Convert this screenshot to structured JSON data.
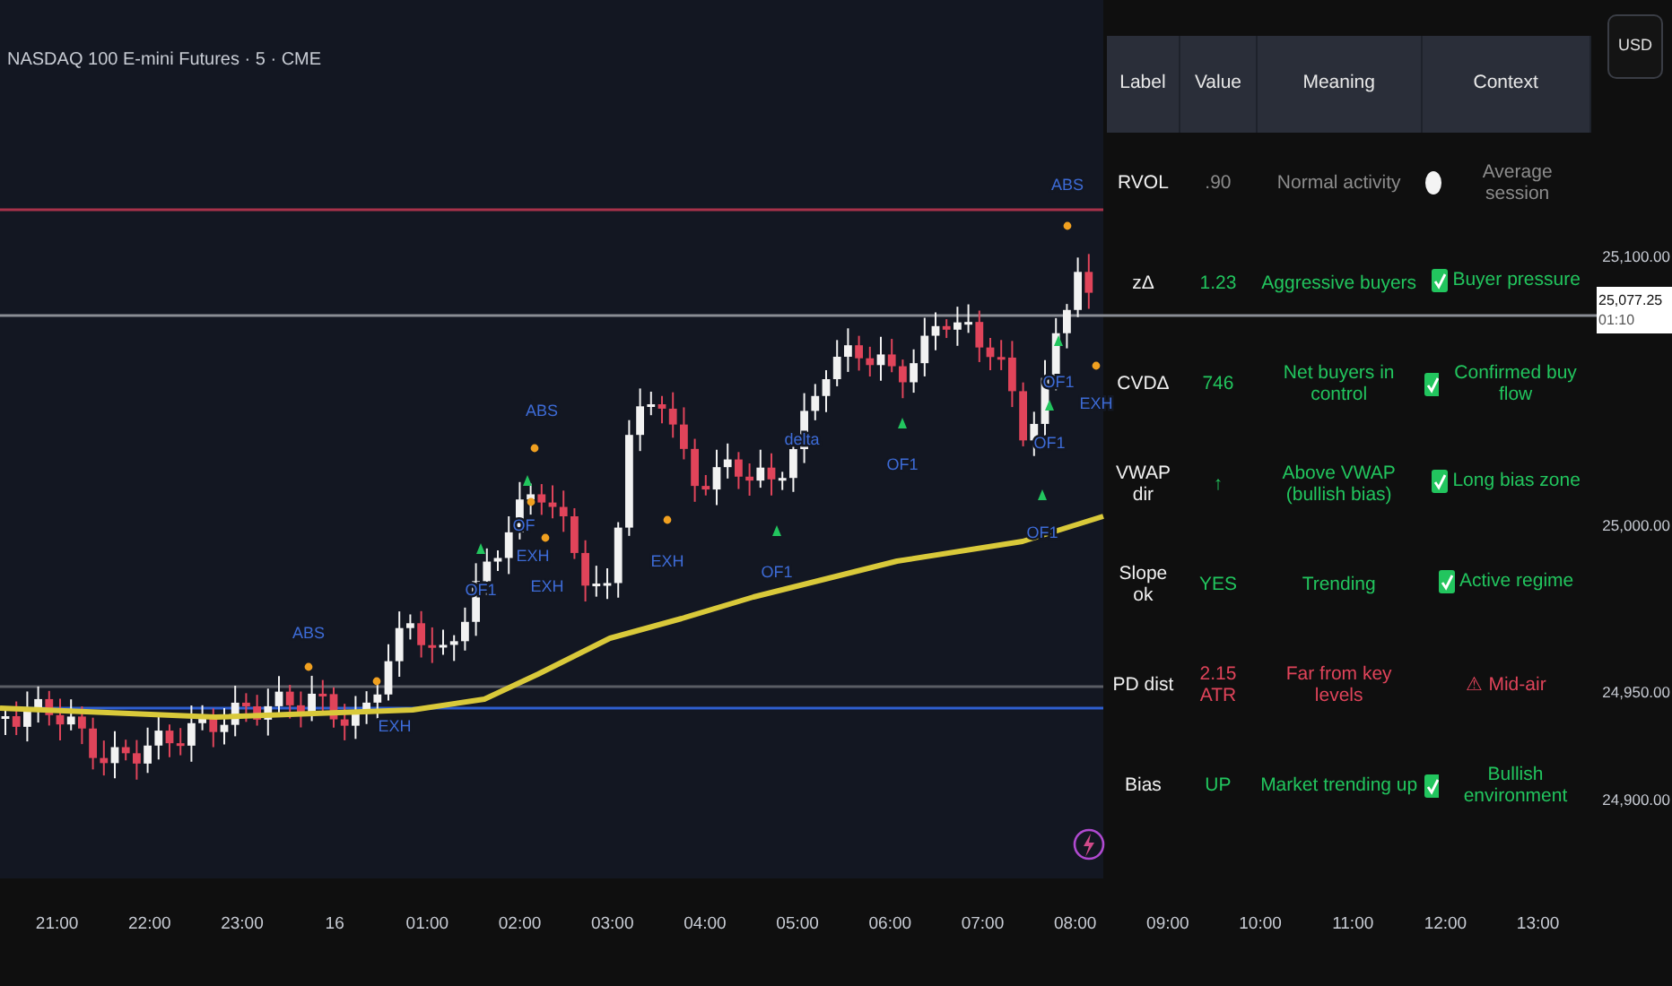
{
  "chart": {
    "title": "NASDAQ 100 E-mini Futures · 5 · CME",
    "annotations": [
      {
        "text": "ABS"
      },
      {
        "text": "EXH"
      },
      {
        "text": "OF1"
      },
      {
        "text": "ABS"
      },
      {
        "text": "OF"
      },
      {
        "text": "EXH"
      },
      {
        "text": "EXH"
      },
      {
        "text": "EXH"
      },
      {
        "text": "OF1"
      },
      {
        "text": "delta"
      },
      {
        "text": "OF1"
      },
      {
        "text": "OF1"
      },
      {
        "text": "OF1"
      },
      {
        "text": "OF1"
      },
      {
        "text": "EXH"
      },
      {
        "text": "ABS"
      }
    ]
  },
  "table": {
    "columns": [
      "Label",
      "Value",
      "Meaning",
      "Context"
    ],
    "rows": [
      {
        "label": "RVOL",
        "value": ".90",
        "meaning": "Normal activity",
        "context": "Average session",
        "kind": "circle",
        "color": "#8c8c8c"
      },
      {
        "label": "zΔ",
        "value": "1.23",
        "meaning": "Aggressive buyers",
        "context": "Buyer pressure",
        "kind": "check",
        "color": "#22c55e"
      },
      {
        "label": "CVDΔ",
        "value": "746",
        "meaning": "Net buyers in control",
        "context": "Confirmed buy flow",
        "kind": "check",
        "color": "#22c55e"
      },
      {
        "label": "VWAP dir",
        "value": "↑",
        "meaning": "Above VWAP (bullish bias)",
        "context": "Long bias zone",
        "kind": "check",
        "color": "#22c55e"
      },
      {
        "label": "Slope ok",
        "value": "YES",
        "meaning": "Trending",
        "context": "Active regime",
        "kind": "check",
        "color": "#22c55e"
      },
      {
        "label": "PD dist",
        "value": "2.15 ATR",
        "meaning": "Far from key levels",
        "context": "⚠ Mid-air",
        "kind": "plain",
        "color": "#e0445a"
      },
      {
        "label": "Bias",
        "value": "UP",
        "meaning": "Market trending up",
        "context": "Bullish environment",
        "kind": "check",
        "color": "#22c55e"
      }
    ]
  },
  "price_axis": {
    "currency": "USD",
    "ticks": [
      "25,100.00",
      "25,000.00",
      "24,950.00",
      "24,900.00"
    ],
    "last_price": "25,077.25",
    "countdown": "01:10"
  },
  "time_axis": [
    "21:00",
    "22:00",
    "23:00",
    "16",
    "01:00",
    "02:00",
    "03:00",
    "04:00",
    "05:00",
    "06:00",
    "07:00",
    "08:00",
    "09:00",
    "10:00",
    "11:00",
    "12:00",
    "13:00"
  ]
}
